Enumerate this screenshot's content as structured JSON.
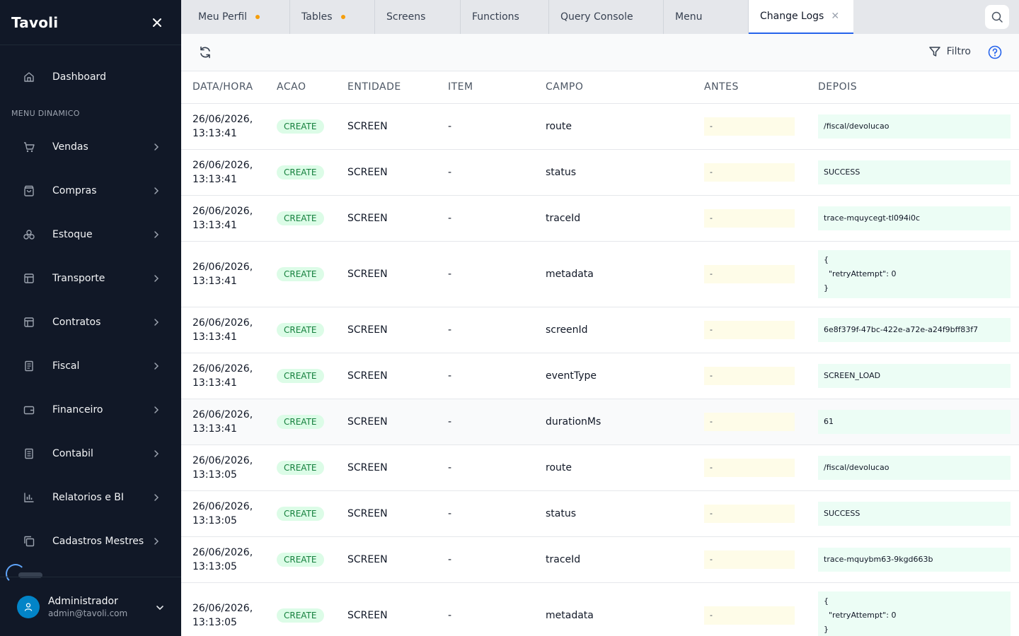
{
  "sidebar": {
    "brand": "Tavoli",
    "dashboard_label": "Dashboard",
    "section_title": "MENU DINAMICO",
    "items": [
      {
        "label": "Vendas",
        "icon": "cart-icon"
      },
      {
        "label": "Compras",
        "icon": "bag-icon"
      },
      {
        "label": "Estoque",
        "icon": "boxes-icon"
      },
      {
        "label": "Transporte",
        "icon": "table-icon"
      },
      {
        "label": "Contratos",
        "icon": "table-icon"
      },
      {
        "label": "Fiscal",
        "icon": "document-icon"
      },
      {
        "label": "Financeiro",
        "icon": "wallet-icon"
      },
      {
        "label": "Contabil",
        "icon": "ledger-icon"
      },
      {
        "label": "Relatorios e BI",
        "icon": "bar-chart-icon"
      },
      {
        "label": "Cadastros Mestres",
        "icon": "copy-icon"
      }
    ],
    "user": {
      "name": "Administrador",
      "email": "admin@tavoli.com"
    }
  },
  "tabs": [
    {
      "label": "Meu Perfil",
      "unsaved": true
    },
    {
      "label": "Tables",
      "unsaved": true
    },
    {
      "label": "Screens",
      "unsaved": false
    },
    {
      "label": "Functions",
      "unsaved": false
    },
    {
      "label": "Query Console",
      "unsaved": false
    },
    {
      "label": "Menu",
      "unsaved": false
    },
    {
      "label": "Change Logs",
      "active": true,
      "closable": true
    }
  ],
  "toolbar": {
    "filter_label": "Filtro"
  },
  "table": {
    "columns": [
      "DATA/HORA",
      "ACAO",
      "ENTIDADE",
      "ITEM",
      "CAMPO",
      "ANTES",
      "DEPOIS"
    ],
    "rows": [
      {
        "date": "26/06/2026,",
        "time": "13:13:41",
        "acao": "CREATE",
        "entidade": "SCREEN",
        "item": "-",
        "campo": "route",
        "antes": "-",
        "depois": "/fiscal/devolucao"
      },
      {
        "date": "26/06/2026,",
        "time": "13:13:41",
        "acao": "CREATE",
        "entidade": "SCREEN",
        "item": "-",
        "campo": "status",
        "antes": "-",
        "depois": "SUCCESS"
      },
      {
        "date": "26/06/2026,",
        "time": "13:13:41",
        "acao": "CREATE",
        "entidade": "SCREEN",
        "item": "-",
        "campo": "traceId",
        "antes": "-",
        "depois": "trace-mquycegt-tl094i0c"
      },
      {
        "date": "26/06/2026,",
        "time": "13:13:41",
        "acao": "CREATE",
        "entidade": "SCREEN",
        "item": "-",
        "campo": "metadata",
        "antes": "-",
        "depois": "{\n  \"retryAttempt\": 0\n}"
      },
      {
        "date": "26/06/2026,",
        "time": "13:13:41",
        "acao": "CREATE",
        "entidade": "SCREEN",
        "item": "-",
        "campo": "screenId",
        "antes": "-",
        "depois": "6e8f379f-47bc-422e-a72e-a24f9bff83f7"
      },
      {
        "date": "26/06/2026,",
        "time": "13:13:41",
        "acao": "CREATE",
        "entidade": "SCREEN",
        "item": "-",
        "campo": "eventType",
        "antes": "-",
        "depois": "SCREEN_LOAD"
      },
      {
        "date": "26/06/2026,",
        "time": "13:13:41",
        "acao": "CREATE",
        "entidade": "SCREEN",
        "item": "-",
        "campo": "durationMs",
        "antes": "-",
        "depois": "61"
      },
      {
        "date": "26/06/2026,",
        "time": "13:13:05",
        "acao": "CREATE",
        "entidade": "SCREEN",
        "item": "-",
        "campo": "route",
        "antes": "-",
        "depois": "/fiscal/devolucao"
      },
      {
        "date": "26/06/2026,",
        "time": "13:13:05",
        "acao": "CREATE",
        "entidade": "SCREEN",
        "item": "-",
        "campo": "status",
        "antes": "-",
        "depois": "SUCCESS"
      },
      {
        "date": "26/06/2026,",
        "time": "13:13:05",
        "acao": "CREATE",
        "entidade": "SCREEN",
        "item": "-",
        "campo": "traceId",
        "antes": "-",
        "depois": "trace-mquybm63-9kgd663b"
      },
      {
        "date": "26/06/2026,",
        "time": "13:13:05",
        "acao": "CREATE",
        "entidade": "SCREEN",
        "item": "-",
        "campo": "metadata",
        "antes": "-",
        "depois": "{\n  \"retryAttempt\": 0\n}"
      }
    ]
  },
  "colors": {
    "sidebar_bg": "#111827",
    "accent": "#2563eb",
    "badge_bg": "#dcfce7",
    "badge_text": "#15803d",
    "antes_bg": "#fefce8",
    "depois_bg": "#ecfdf5",
    "tab_dot": "#f59e0b"
  }
}
